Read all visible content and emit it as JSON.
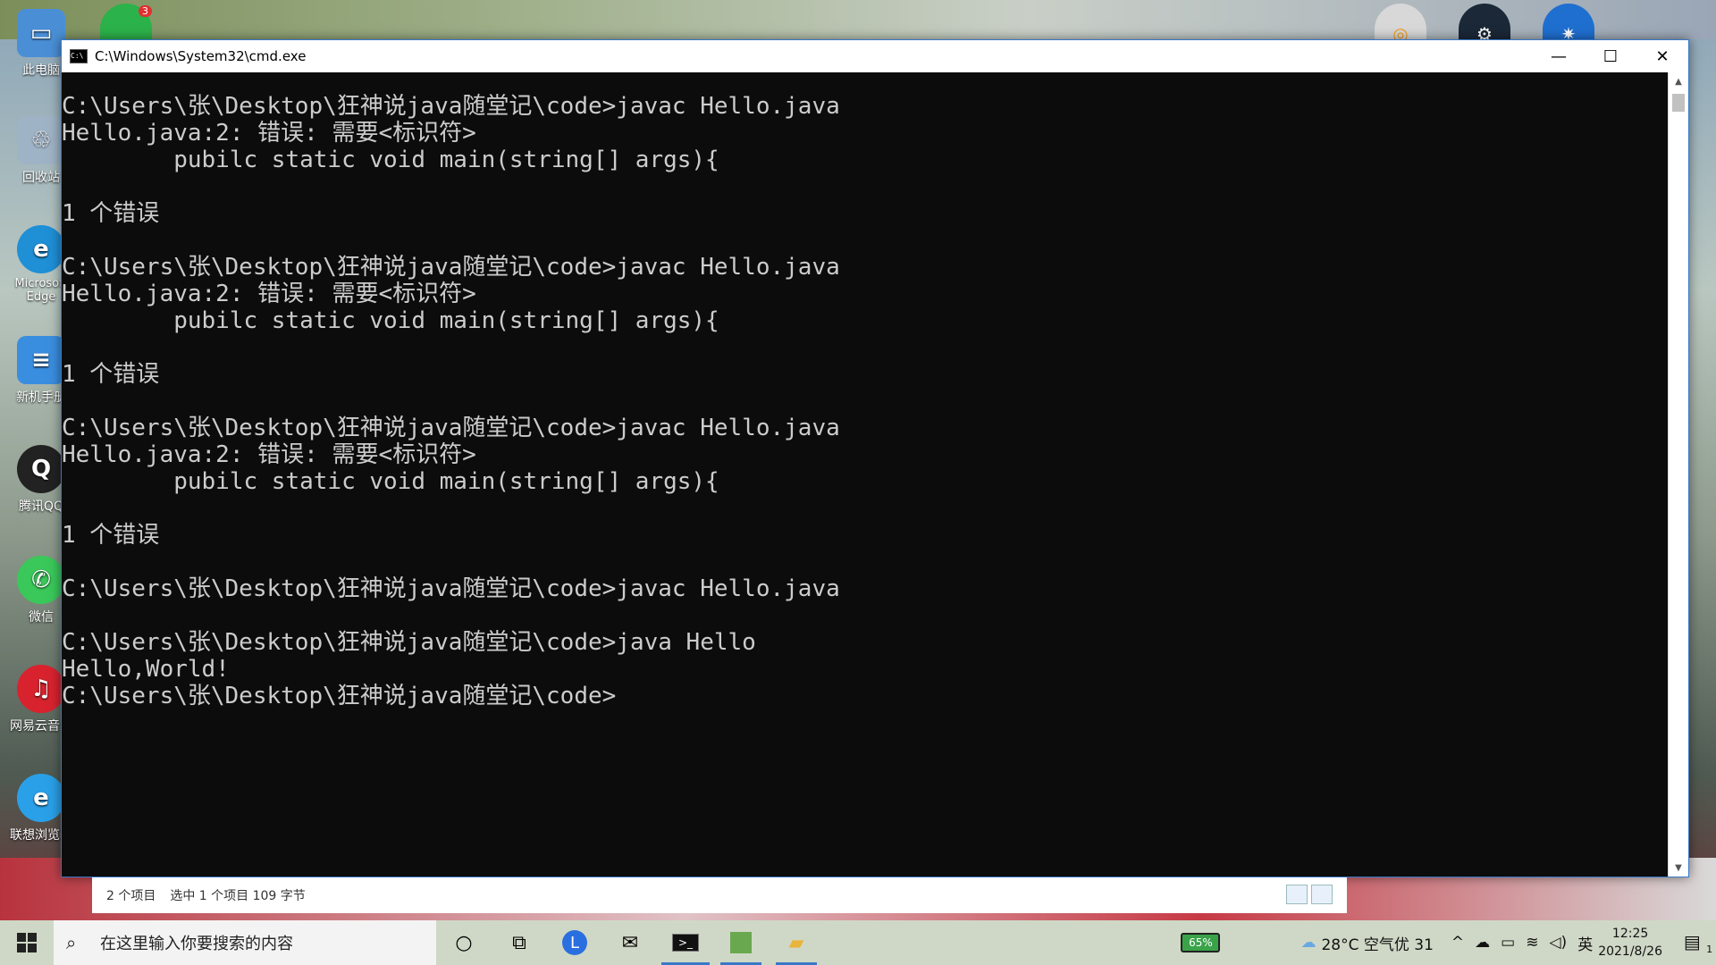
{
  "desktop": {
    "icons": [
      {
        "label": "此电脑",
        "glyph": "▭",
        "color": "#4a8fd6"
      },
      {
        "label": "回收站",
        "glyph": "♲",
        "color": "#9fb3c6"
      },
      {
        "label": "Microsoft Edge",
        "glyph": "e",
        "color": "#1f8fd6"
      },
      {
        "label": "新机手册",
        "glyph": "≡",
        "color": "#3a8ee0"
      },
      {
        "label": "腾讯QQ",
        "glyph": "Q",
        "color": "#222222"
      },
      {
        "label": "微信",
        "glyph": "✆",
        "color": "#3ac85a"
      },
      {
        "label": "网易云音乐",
        "glyph": "♫",
        "color": "#d8232f"
      },
      {
        "label": "联想浏览器",
        "glyph": "e",
        "color": "#2aa0e8"
      }
    ],
    "top_badge": "3"
  },
  "window": {
    "title": "C:\\Windows\\System32\\cmd.exe",
    "controls": {
      "minimize": "—",
      "maximize": "☐",
      "close": "✕"
    }
  },
  "console": {
    "lines": [
      "C:\\Users\\张\\Desktop\\狂神说java随堂记\\code>javac Hello.java",
      "Hello.java:2: 错误: 需要<标识符>",
      "        pubilc static void main(string[] args){",
      "",
      "1 个错误",
      "",
      "C:\\Users\\张\\Desktop\\狂神说java随堂记\\code>javac Hello.java",
      "Hello.java:2: 错误: 需要<标识符>",
      "        pubilc static void main(string[] args){",
      "",
      "1 个错误",
      "",
      "C:\\Users\\张\\Desktop\\狂神说java随堂记\\code>javac Hello.java",
      "Hello.java:2: 错误: 需要<标识符>",
      "        pubilc static void main(string[] args){",
      "",
      "1 个错误",
      "",
      "C:\\Users\\张\\Desktop\\狂神说java随堂记\\code>javac Hello.java",
      "",
      "C:\\Users\\张\\Desktop\\狂神说java随堂记\\code>java Hello",
      "Hello,World!",
      "C:\\Users\\张\\Desktop\\狂神说java随堂记\\code>"
    ]
  },
  "explorer_status": {
    "items_count": "2 个项目",
    "selected": "选中 1 个项目  109 字节"
  },
  "taskbar": {
    "search_placeholder": "在这里输入你要搜索的内容",
    "battery": "65%",
    "weather": "28°C 空气优 31",
    "ime": "英",
    "time": "12:25",
    "date": "2021/8/26",
    "notif_count": "1"
  }
}
